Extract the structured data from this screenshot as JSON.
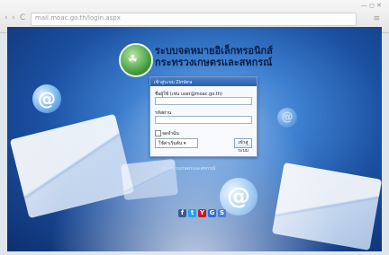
{
  "browser": {
    "window_controls": "— ◻ ✕",
    "back_icon": "‹",
    "forward_icon": "›",
    "reload_icon": "C",
    "address": "mail.moac.go.th/login.aspx",
    "menu_icon": "≡"
  },
  "header": {
    "title_line1": "ระบบจดหมายอิเล็กทรอนิกส์",
    "title_line2": "กระทรวงเกษตรและสหกรณ์",
    "logo_mark": "☘"
  },
  "login": {
    "heading": "เข้าสู่ระบบ Zimbra",
    "username_label": "ชื่อผู้ใช้ (เช่น user@moac.go.th)",
    "password_label": "รหัสผ่าน",
    "remember_label": "จดจำฉัน",
    "version_value": "ใช้ค่าเริ่มต้น ▾",
    "submit_label": "เข้าสู่ระบบ"
  },
  "footer": {
    "text": "กระทรวงเกษตรและสหกรณ์"
  },
  "social": [
    {
      "glyph": "f",
      "color": "#3b5998"
    },
    {
      "glyph": "t",
      "color": "#1da1f2"
    },
    {
      "glyph": "Y",
      "color": "#cc181e"
    },
    {
      "glyph": "G",
      "color": "#2a6fd6"
    },
    {
      "glyph": "S",
      "color": "#4a7fd0"
    }
  ]
}
